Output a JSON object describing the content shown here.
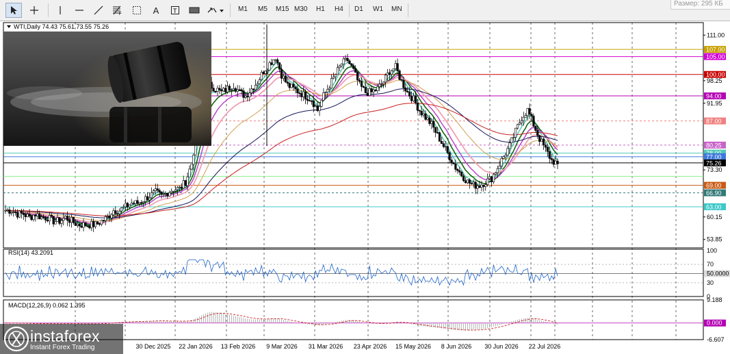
{
  "toolbar": {
    "timeframes": [
      "M1",
      "M5",
      "M15",
      "M30",
      "H1",
      "H4",
      "D1",
      "W1",
      "MN"
    ],
    "tools": [
      "cursor-icon",
      "crosshair-icon",
      "vertical-line-icon",
      "horizontal-line-icon",
      "trend-line-icon",
      "fibonacci-icon",
      "channel-icon",
      "text-icon",
      "label-icon",
      "rectangle-icon",
      "arrows-icon"
    ],
    "size_label": "Размер: 295 КБ"
  },
  "chart": {
    "header": "WTI,Daily  74.43 75.61 73.55 75.26",
    "rsi_label": "RSI(14) 43.2091",
    "macd_label": "MACD(12,26,9) 0.062 1.395",
    "logo_name": "instaforex",
    "logo_tag": "Instant Forex Trading",
    "colors": {
      "candle": "#000000",
      "sma200": "#c81e1e",
      "sma100": "#14145a",
      "ema50": "#d2a050",
      "ema20_pink": "#f0a0b4",
      "ema14_violet": "#b43cc8",
      "ema9_green": "#146414",
      "ema5_teal": "#50c8b4"
    }
  },
  "chart_data": [
    {
      "type": "line",
      "title": "WTI,Daily",
      "x_ticks": [
        "30 Dec 2025",
        "22 Jan 2026",
        "13 Feb 2026",
        "9 Mar 2026",
        "31 Mar 2026",
        "23 Apr 2026",
        "15 May 2026",
        "8 Jun 2026",
        "30 Jun 2026",
        "22 Jul 2026"
      ],
      "y_ticks": [
        "111.00",
        "98.25",
        "91.95",
        "73.30",
        "60.15",
        "53.85"
      ],
      "ylim": [
        51.5,
        114.5
      ],
      "ohlc_last": {
        "open": 74.43,
        "high": 75.61,
        "low": 73.55,
        "close": 75.26
      },
      "levels": [
        {
          "value": 107.0,
          "label": "107.00",
          "color": "#c8a000"
        },
        {
          "value": 105.0,
          "label": "105.00",
          "color": "#d200d2"
        },
        {
          "value": 100.0,
          "label": "100.00",
          "color": "#c80000"
        },
        {
          "value": 94.0,
          "label": "94.00",
          "color": "#b400b4"
        },
        {
          "value": 87.0,
          "label": "87.00",
          "color": "#f08080"
        },
        {
          "value": 80.25,
          "label": "80.25",
          "color": "#c864c8"
        },
        {
          "value": 78.0,
          "label": "78.00",
          "color": "#50c8b4"
        },
        {
          "value": 77.0,
          "label": "77.00",
          "color": "#3c78dc"
        },
        {
          "value": 75.26,
          "label": "75.26",
          "color": "#000000"
        },
        {
          "value": 71.5,
          "label": "",
          "color": "#90ee90"
        },
        {
          "value": 69.0,
          "label": "69.00",
          "color": "#c85a14"
        },
        {
          "value": 66.9,
          "label": "66.90",
          "color": "#327878"
        },
        {
          "value": 63.0,
          "label": "63.00",
          "color": "#3cc8c8"
        }
      ],
      "close_approx": [
        62,
        62,
        61,
        61,
        60,
        61,
        60,
        60,
        59,
        59,
        60,
        59,
        58,
        58,
        58,
        58,
        59,
        60,
        62,
        62,
        63,
        64,
        64,
        65,
        66,
        67,
        66,
        67,
        68,
        68,
        70,
        75,
        85,
        94,
        97,
        96,
        95,
        96,
        97,
        95,
        94,
        96,
        98,
        101,
        103,
        105,
        100,
        97,
        96,
        95,
        94,
        93,
        90,
        94,
        97,
        100,
        103,
        104,
        101,
        97,
        95,
        95,
        96,
        98,
        101,
        102,
        98,
        95,
        93,
        90,
        88,
        86,
        83,
        80,
        77,
        74,
        72,
        70,
        69,
        69,
        70,
        71,
        74,
        77,
        80,
        84,
        88,
        90,
        86,
        82,
        79,
        76,
        75
      ]
    },
    {
      "type": "line",
      "title": "RSI(14) 43.2091",
      "ylim": [
        0,
        100
      ],
      "y_ticks": [
        "100",
        "70",
        "50.0000",
        "30",
        "0"
      ],
      "levels": [
        70,
        50,
        30
      ]
    },
    {
      "type": "bar",
      "title": "MACD(12,26,9) 0.062 1.395",
      "y_ticks": [
        "9.188",
        "0.000",
        "-6.607"
      ],
      "ylim": [
        -6.607,
        9.188
      ]
    }
  ]
}
